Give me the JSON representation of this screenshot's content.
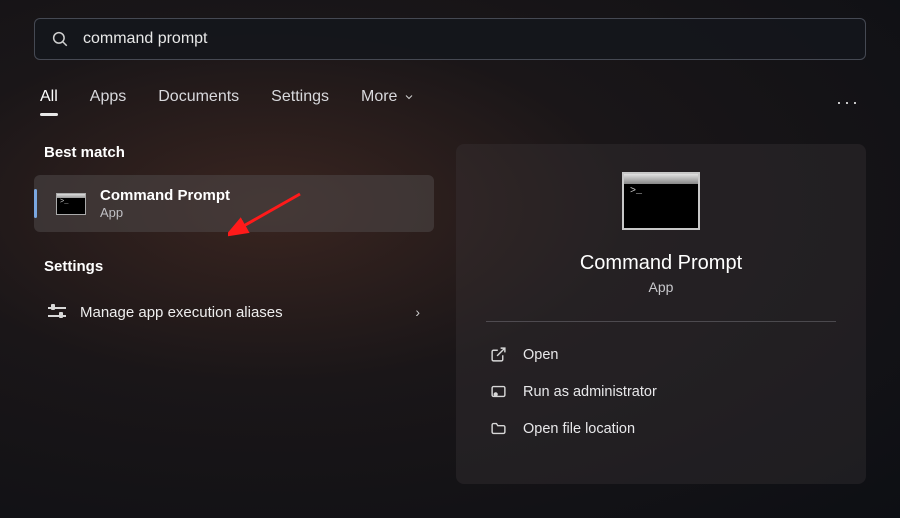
{
  "search": {
    "value": "command prompt"
  },
  "tabs": {
    "items": [
      "All",
      "Apps",
      "Documents",
      "Settings",
      "More"
    ],
    "active_index": 0
  },
  "left": {
    "best_match_label": "Best match",
    "result": {
      "title": "Command Prompt",
      "subtitle": "App"
    },
    "settings_label": "Settings",
    "settings_item": "Manage app execution aliases"
  },
  "preview": {
    "title": "Command Prompt",
    "subtitle": "App",
    "actions": [
      "Open",
      "Run as administrator",
      "Open file location"
    ]
  }
}
